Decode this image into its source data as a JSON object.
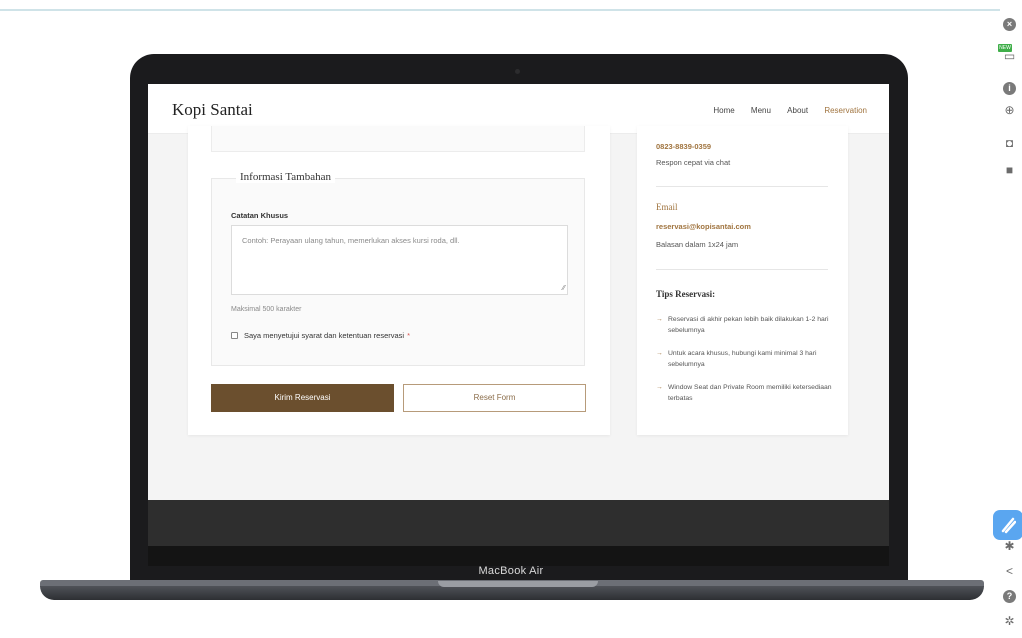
{
  "device": {
    "label": "MacBook Air"
  },
  "site": {
    "brand": "Kopi Santai",
    "nav": [
      "Home",
      "Menu",
      "About",
      "Reservation"
    ],
    "active_nav": "Reservation"
  },
  "form": {
    "section_title": "Informasi Tambahan",
    "notes_label": "Catatan Khusus",
    "notes_placeholder": "Contoh: Perayaan ulang tahun, memerlukan akses kursi roda, dll.",
    "notes_help": "Maksimal 500 karakter",
    "agree_label": "Saya menyetujui syarat dan ketentuan reservasi",
    "required_mark": "*",
    "submit_label": "Kirim Reservasi",
    "reset_label": "Reset Form"
  },
  "contact": {
    "phone": "0823-8839-0359",
    "phone_note": "Respon cepat via chat",
    "email_heading": "Email",
    "email": "reservasi@kopisantai.com",
    "email_note": "Balasan dalam 1x24 jam",
    "tips_heading": "Tips Reservasi:",
    "tips": [
      "Reservasi di akhir pekan lebih baik dilakukan 1-2 hari sebelumnya",
      "Untuk acara khusus, hubungi kami minimal 3 hari sebelumnya",
      "Window Seat dan Private Room memiliki ketersediaan terbatas"
    ],
    "tip_marker": "→"
  },
  "toolbar": {
    "badge": "NEW",
    "icons": [
      "close-circle-icon",
      "extension-icon",
      "info-icon",
      "zoom-icon",
      "camera-icon",
      "video-icon",
      "pin-icon",
      "share-icon",
      "help-icon",
      "settings-icon"
    ]
  },
  "colors": {
    "accent": "#a0743f",
    "button": "#6b4f2e",
    "footer": "#2e2e2e"
  }
}
